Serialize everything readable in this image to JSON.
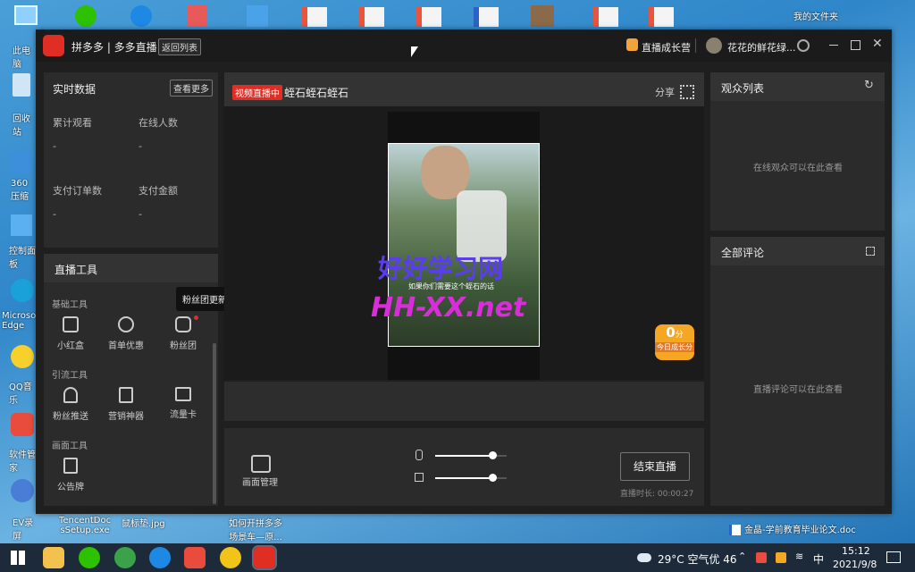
{
  "desktop": {
    "top_right_label": "我的文件夹",
    "left_labels": [
      "此电脑",
      "回收站",
      "360压缩",
      "控制面板",
      "Microsoft Edge",
      "QQ音乐",
      "软件管家",
      "EV录屏"
    ],
    "bottom_files": [
      {
        "name": "TencentDocsSetup.exe",
        "l1": "TencentDoc",
        "l2": "sSetup.exe"
      },
      {
        "name": "鼠标垫.jpg",
        "l1": "鼠标垫.jpg",
        "l2": ""
      },
      {
        "name": "如何开拼多多场景车—原...",
        "l1": "如何开拼多多",
        "l2": "场景车—原..."
      }
    ],
    "notify_file": "金晶-学前教育毕业论文.doc"
  },
  "app": {
    "title": "拼多多 | 多多直播",
    "back_button": "返回列表",
    "growth_camp": "直播成长营",
    "username": "花花的鲜花绿...",
    "realtime": {
      "title": "实时数据",
      "more_button": "查看更多",
      "stats": [
        {
          "label": "累计观看",
          "value": "-"
        },
        {
          "label": "在线人数",
          "value": "-"
        },
        {
          "label": "支付订单数",
          "value": "-"
        },
        {
          "label": "支付金额",
          "value": "-"
        }
      ]
    },
    "tools": {
      "title": "直播工具",
      "tooltip": "粉丝团更新",
      "section_basic": "基础工具",
      "section_traffic": "引流工具",
      "section_screen": "画面工具",
      "basic": [
        "小红盒",
        "首单优惠",
        "粉丝团"
      ],
      "traffic": [
        "粉丝推送",
        "营销神器",
        "流量卡"
      ],
      "screen": [
        "公告牌"
      ]
    },
    "stream": {
      "badge": "视频直播中",
      "title": "蛭石蛭石蛭石",
      "share": "分享",
      "subtitle": "如果你们需要这个蛭石的话",
      "watermark1": "好好学习网",
      "watermark2": "HH-XX.net",
      "score_value": "0",
      "score_unit": "分",
      "score_label": "今日成长分"
    },
    "control": {
      "screen_mgmt": "画面管理",
      "end_button": "结束直播",
      "duration": "直播时长: 00:00:27",
      "mic_level": 0.8,
      "speaker_level": 0.8
    },
    "viewers": {
      "title": "观众列表",
      "empty": "在线观众可以在此查看"
    },
    "comments": {
      "title": "全部评论",
      "empty": "直播评论可以在此查看"
    }
  },
  "taskbar": {
    "weather": "29°C 空气优 46",
    "ime": "中",
    "time": "15:12",
    "date": "2021/9/8"
  },
  "colors": {
    "accent": "#e02e24",
    "panel": "#2b2b2b",
    "window": "#1f1f1f"
  }
}
